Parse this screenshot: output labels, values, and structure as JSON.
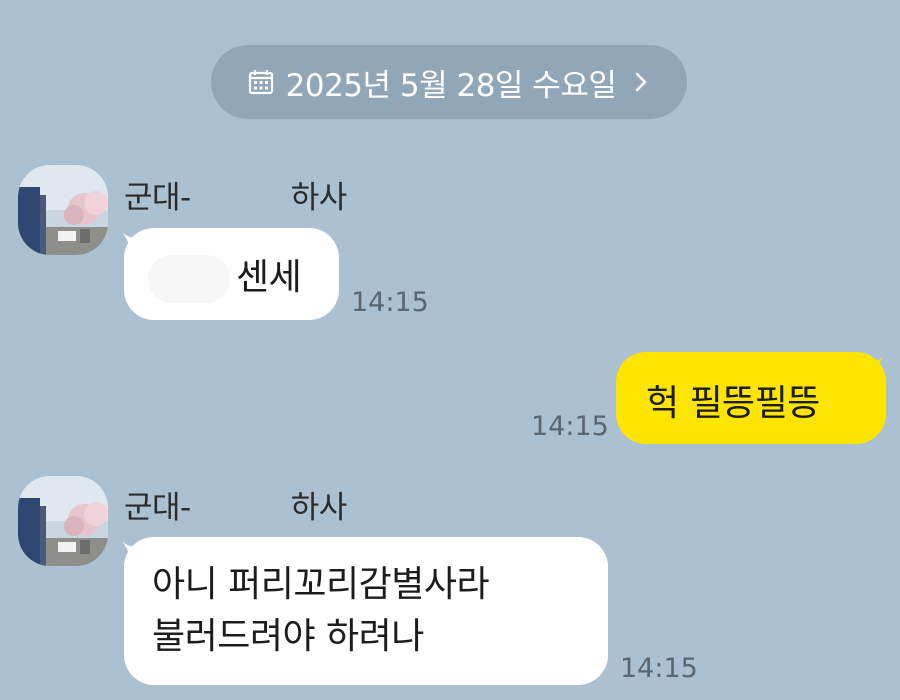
{
  "date_separator": {
    "label": "2025년 5월 28일 수요일"
  },
  "messages": [
    {
      "sender": "군대-",
      "sender_suffix": "하사",
      "text": "센세",
      "time": "14:15"
    },
    {
      "text": "헉 필뜽필뜽",
      "time": "14:15"
    },
    {
      "sender": "군대-",
      "sender_suffix": "하사",
      "line1": "아니 퍼리꼬리감별사라",
      "line2": "불러드려야 하려나",
      "time": "14:15"
    }
  ],
  "colors": {
    "background": "#abc1d1",
    "date_pill": "#91a6b6",
    "incoming_bubble": "#ffffff",
    "outgoing_bubble": "#fee500"
  }
}
